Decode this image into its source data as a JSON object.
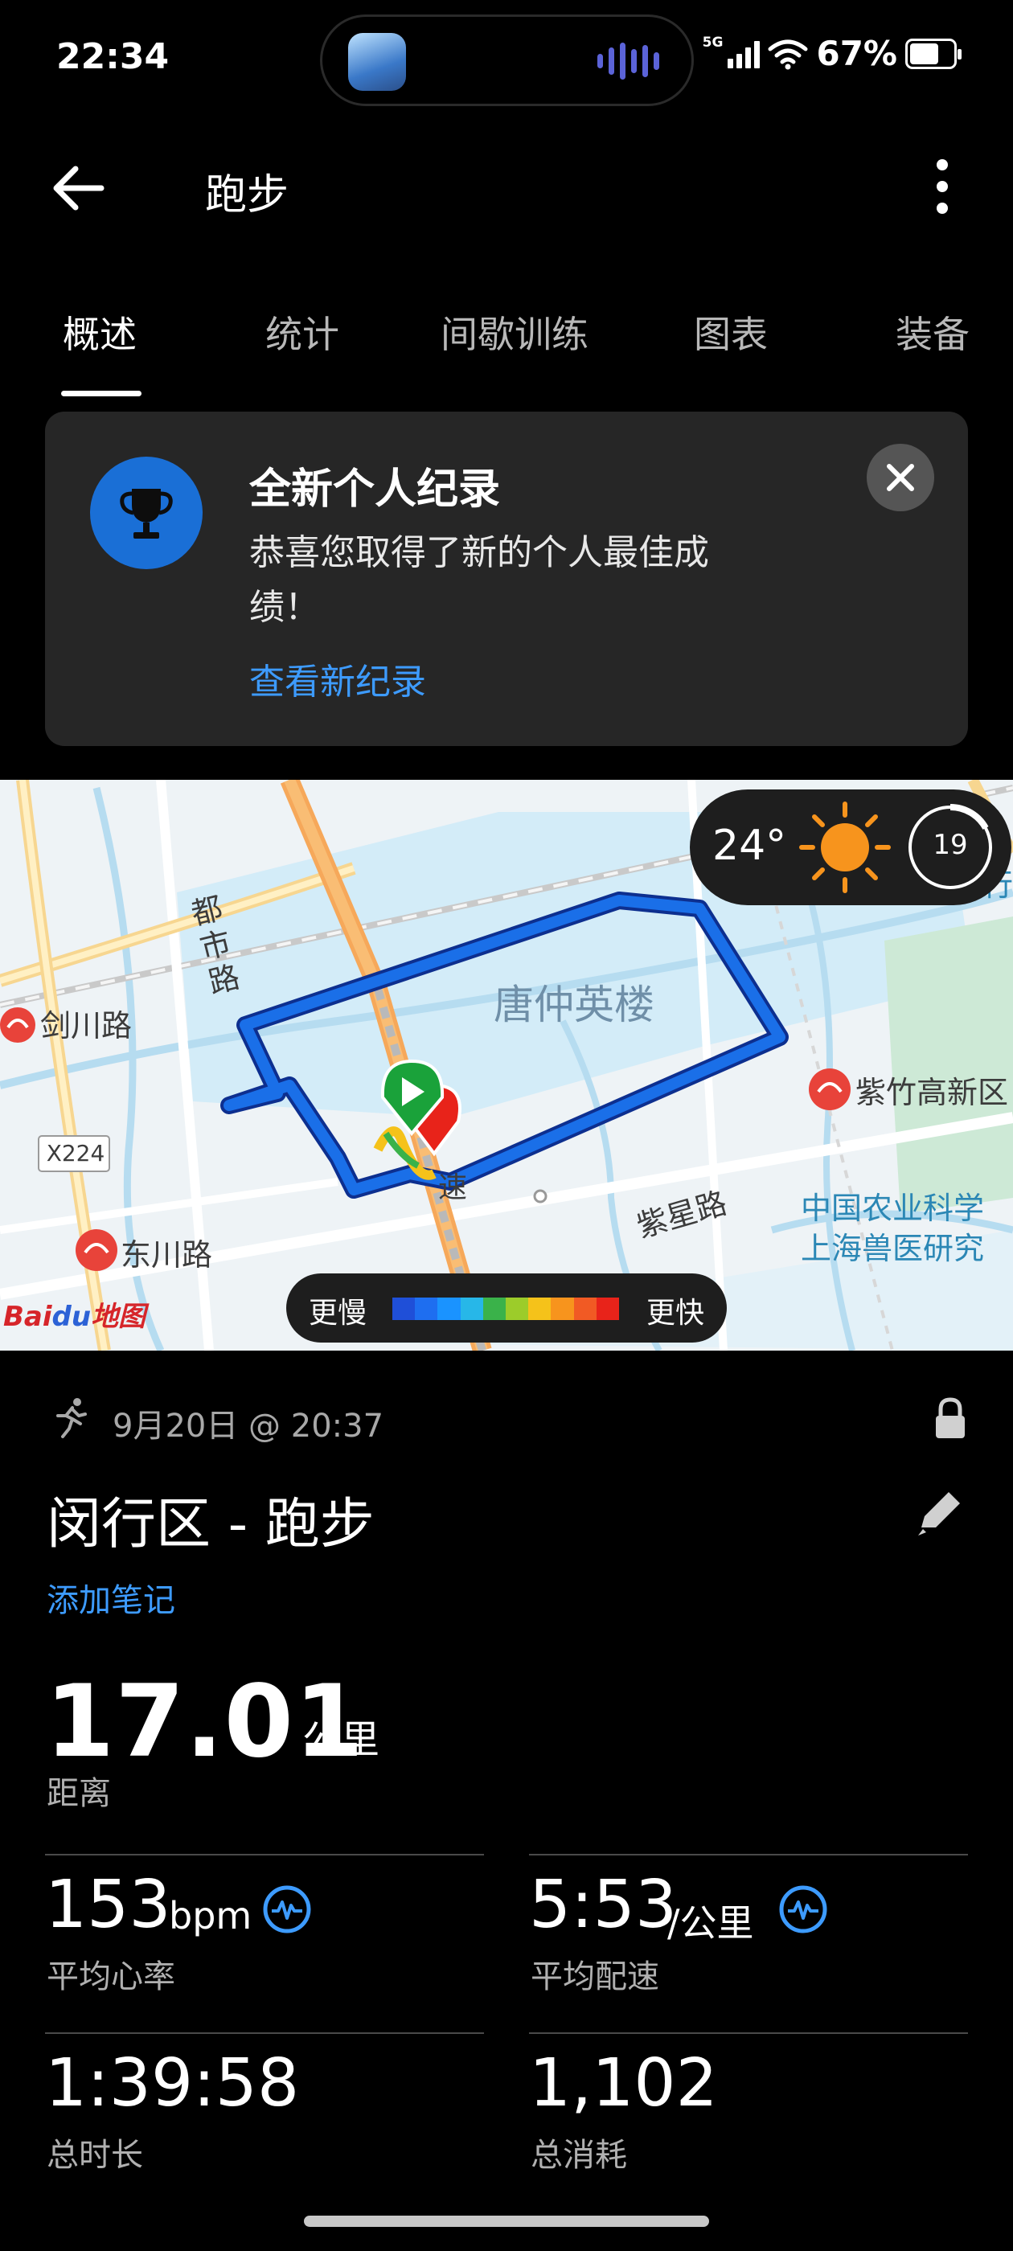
{
  "status_bar": {
    "time": "22:34",
    "network": "5G",
    "battery_percent": "67%",
    "battery_level": 0.67
  },
  "header": {
    "title": "跑步"
  },
  "tabs": [
    {
      "label": "概述",
      "active": true
    },
    {
      "label": "统计",
      "active": false
    },
    {
      "label": "间歇训练",
      "active": false
    },
    {
      "label": "图表",
      "active": false
    },
    {
      "label": "装备",
      "active": false
    }
  ],
  "record_card": {
    "title": "全新个人纪录",
    "body": "恭喜您取得了新的个人最佳成绩！",
    "link": "查看新纪录"
  },
  "map": {
    "labels": {
      "dushi_road": "都市路",
      "jianchuan_road": "剑川路",
      "x224": "X224",
      "dongchuan_road": "东川路",
      "tang_zhong_ying": "唐仲英楼",
      "zizhu": "紫竹高新区",
      "zixing_road": "紫星路",
      "caas_line1": "中国农业科学",
      "caas_line2": "上海兽医研究",
      "expressway_char": "速",
      "right_edge_text": "行",
      "baidu_logo": "Baidu地图"
    },
    "weather": {
      "temperature": "24°",
      "icon": "sun-icon",
      "uv_value": "19"
    },
    "legend": {
      "slow_label": "更慢",
      "fast_label": "更快",
      "colors": [
        "#1f4fd8",
        "#1e6ef0",
        "#1a93ff",
        "#27b7e8",
        "#3ab24a",
        "#9ccc2a",
        "#f5c21a",
        "#f7941d",
        "#f15a24",
        "#e8231a"
      ]
    },
    "accent_colors": {
      "route": "#1a6fe8",
      "start_marker": "#1aa23a",
      "end_marker": "#e8231a"
    }
  },
  "activity": {
    "icon": "runner-icon",
    "datetime": "9月20日 @ 20:37",
    "title": "闵行区 - 跑步",
    "add_note": "添加笔记",
    "distance": {
      "value": "17.01",
      "unit": "公里",
      "label": "距离"
    },
    "stats": [
      {
        "value": "153",
        "unit": "bpm",
        "label": "平均心率",
        "icon": "heart-rate-icon"
      },
      {
        "value": "5:53",
        "unit": "/公里",
        "label": "平均配速",
        "icon": "pace-chart-icon"
      },
      {
        "value": "1:39:58",
        "unit": "",
        "label": "总时长"
      },
      {
        "value": "1,102",
        "unit": "",
        "label": "总消耗"
      }
    ]
  }
}
